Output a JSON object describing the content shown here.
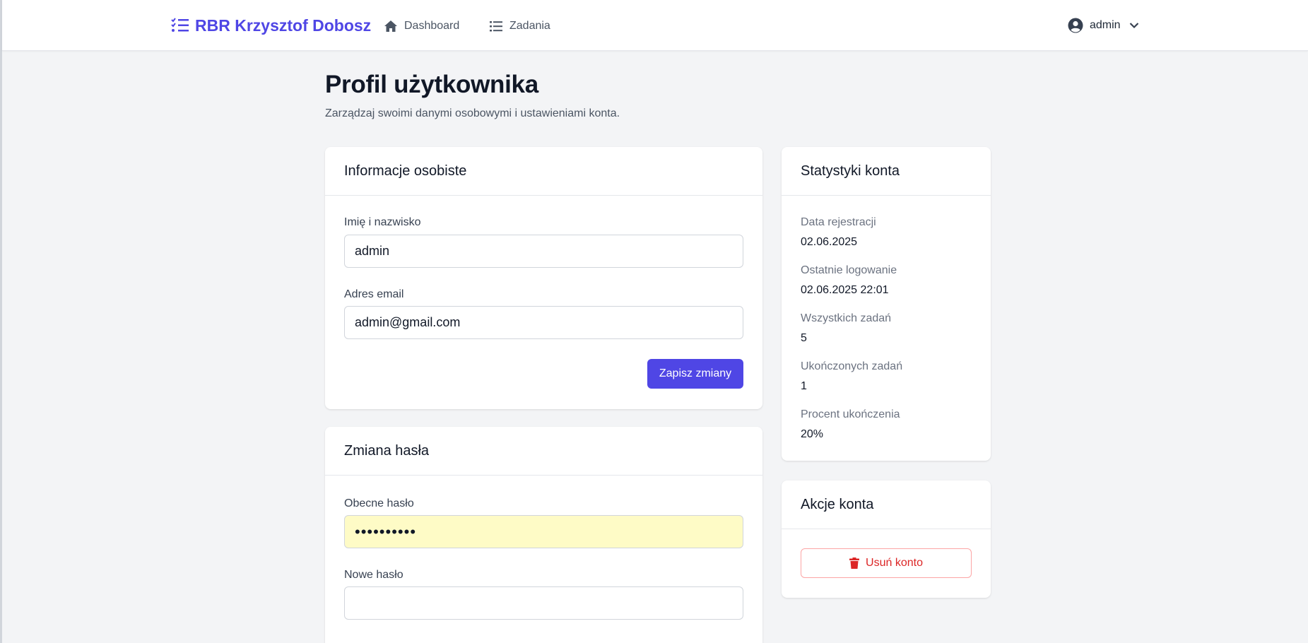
{
  "nav": {
    "brand": "RBR Krzysztof Dobosz",
    "brand_icon": "list-check-icon",
    "links": [
      {
        "label": "Dashboard",
        "icon": "home-icon"
      },
      {
        "label": "Zadania",
        "icon": "list-icon"
      }
    ],
    "user": {
      "name": "admin",
      "icon": "user-circle-icon"
    }
  },
  "header": {
    "title": "Profil użytkownika",
    "subtitle": "Zarządzaj swoimi danymi osobowymi i ustawieniami konta."
  },
  "personal": {
    "title": "Informacje osobiste",
    "name_label": "Imię i nazwisko",
    "name_value": "admin",
    "email_label": "Adres email",
    "email_value": "admin@gmail.com",
    "save_label": "Zapisz zmiany"
  },
  "password": {
    "title": "Zmiana hasła",
    "current_label": "Obecne hasło",
    "current_value": "••••••••••",
    "new_label": "Nowe hasło",
    "new_value": ""
  },
  "stats": {
    "title": "Statystyki konta",
    "items": [
      {
        "label": "Data rejestracji",
        "value": "02.06.2025"
      },
      {
        "label": "Ostatnie logowanie",
        "value": "02.06.2025 22:01"
      },
      {
        "label": "Wszystkich zadań",
        "value": "5"
      },
      {
        "label": "Ukończonych zadań",
        "value": "1"
      },
      {
        "label": "Procent ukończenia",
        "value": "20%"
      }
    ]
  },
  "actions": {
    "title": "Akcje konta",
    "delete_label": "Usuń konto",
    "delete_icon": "trash-icon"
  },
  "colors": {
    "accent": "#4f46e5",
    "danger": "#dc2626",
    "background": "#f3f4f6"
  }
}
